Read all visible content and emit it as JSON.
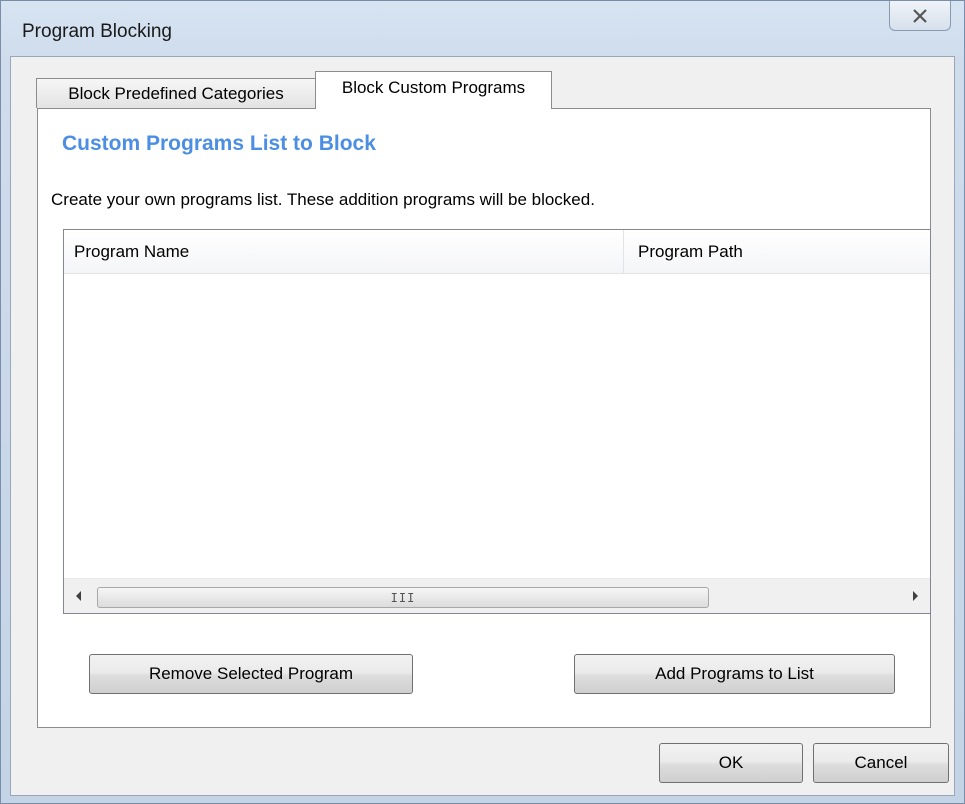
{
  "window": {
    "title": "Program Blocking"
  },
  "tabs": [
    {
      "label": "Block Predefined Categories",
      "selected": false
    },
    {
      "label": "Block Custom Programs",
      "selected": true
    }
  ],
  "panel": {
    "section_title": "Custom Programs List to Block",
    "description": "Create your own programs list. These addition programs will be blocked."
  },
  "list": {
    "columns": [
      "Program Name",
      "Program Path"
    ],
    "rows": [],
    "scrollbar_grip": "III"
  },
  "buttons": {
    "remove_label": "Remove Selected Program",
    "add_label": "Add Programs to List",
    "ok_label": "OK",
    "cancel_label": "Cancel"
  },
  "icons": {
    "close": "close-icon",
    "scroll_left": "arrow-left-icon",
    "scroll_right": "arrow-right-icon"
  },
  "colors": {
    "section_title": "#4c8ee3",
    "frame": "#cfdcec",
    "client": "#f0f0f0"
  }
}
